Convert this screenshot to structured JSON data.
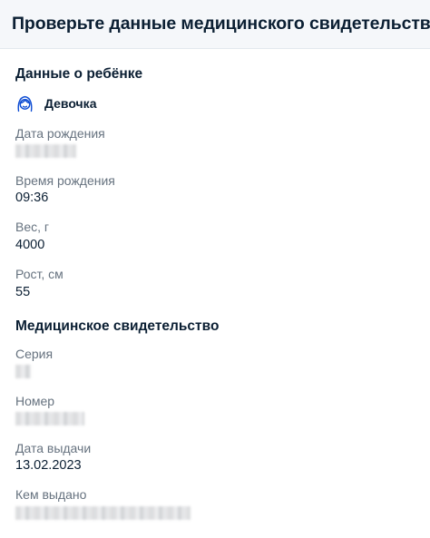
{
  "header": {
    "title": "Проверьте данные медицинского свидетельства"
  },
  "child": {
    "section_title": "Данные о ребёнке",
    "gender_icon": "girl-avatar-icon",
    "gender": "Девочка",
    "birth_date": {
      "label": "Дата рождения"
    },
    "birth_time": {
      "label": "Время рождения",
      "value": "09:36"
    },
    "weight": {
      "label": "Вес, г",
      "value": "4000"
    },
    "height": {
      "label": "Рост, см",
      "value": "55"
    }
  },
  "certificate": {
    "section_title": "Медицинское свидетельство",
    "series": {
      "label": "Серия"
    },
    "number": {
      "label": "Номер"
    },
    "issue_date": {
      "label": "Дата выдачи",
      "value": "13.02.2023"
    },
    "issued_by": {
      "label": "Кем выдано"
    }
  },
  "colors": {
    "accent": "#0d4cd3",
    "text": "#0b1f33",
    "muted": "#66727f",
    "header_bg": "#f5f7fa"
  }
}
